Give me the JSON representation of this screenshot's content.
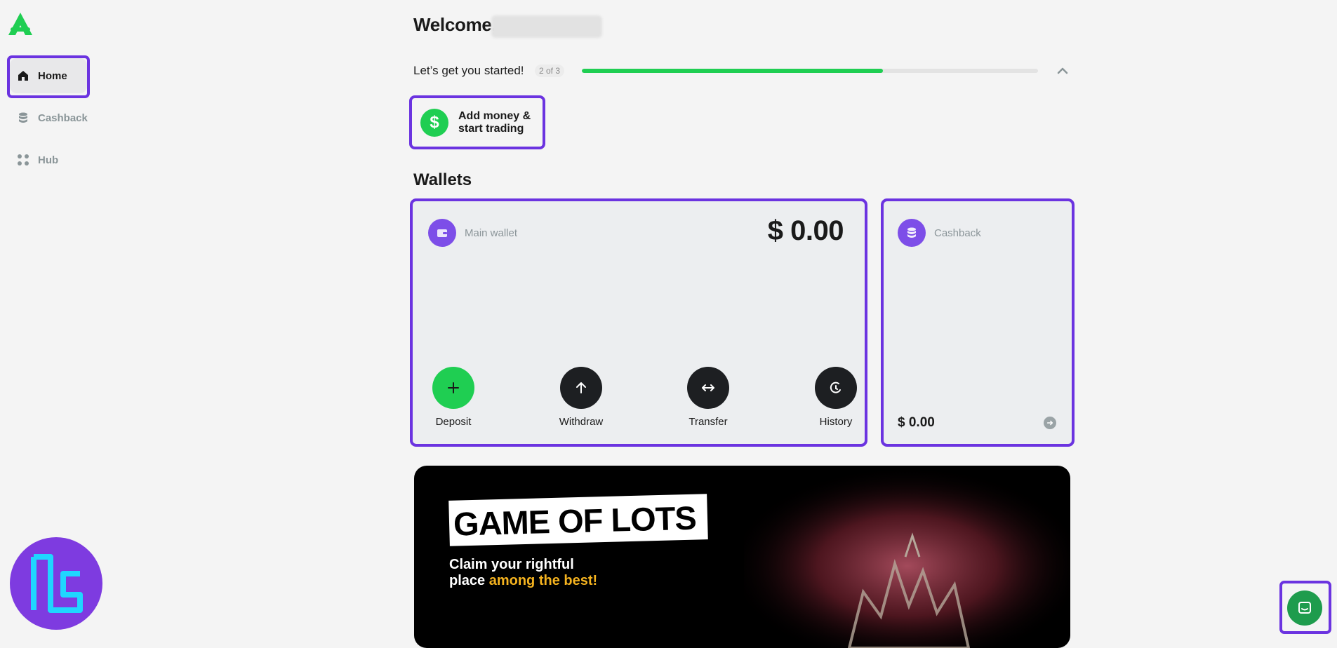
{
  "sidebar": {
    "logo": "app-logo",
    "items": [
      {
        "label": "Home",
        "icon": "home-icon",
        "active": true
      },
      {
        "label": "Cashback",
        "icon": "coins-icon",
        "active": false
      },
      {
        "label": "Hub",
        "icon": "grid-dots-icon",
        "active": false
      }
    ]
  },
  "header": {
    "welcome": "Welcome,"
  },
  "onboarding": {
    "label": "Let’s get you started!",
    "step_badge": "2 of 3",
    "progress": 0.66,
    "collapse_icon": "chevron-up-icon"
  },
  "add_money": {
    "icon": "dollar-icon",
    "line1": "Add money &",
    "line2": "start trading"
  },
  "wallets": {
    "title": "Wallets",
    "main": {
      "label": "Main wallet",
      "balance": "$ 0.00",
      "icon": "wallet-icon",
      "actions": [
        {
          "label": "Deposit",
          "icon": "plus-icon",
          "color": "#1fce52"
        },
        {
          "label": "Withdraw",
          "icon": "arrow-up-icon",
          "color": "#1d1f22"
        },
        {
          "label": "Transfer",
          "icon": "arrows-horizontal-icon",
          "color": "#1d1f22"
        },
        {
          "label": "History",
          "icon": "clock-icon",
          "color": "#1d1f22"
        }
      ]
    },
    "cashback": {
      "label": "Cashback",
      "balance": "$ 0.00",
      "icon": "coins-icon",
      "arrow_icon": "arrow-right-circle-icon"
    }
  },
  "banner": {
    "title": "GAME OF LOTS",
    "sub_line1": "Claim your rightful",
    "sub_line2_plain": "place ",
    "sub_line2_highlight": "among the best!",
    "highlight_color": "#f5b31f"
  },
  "colors": {
    "accent_outline": "#6b33e0",
    "brand_green": "#1fce52",
    "wallet_icon_bg": "#7d4ee8"
  },
  "chat": {
    "icon": "chat-icon"
  }
}
